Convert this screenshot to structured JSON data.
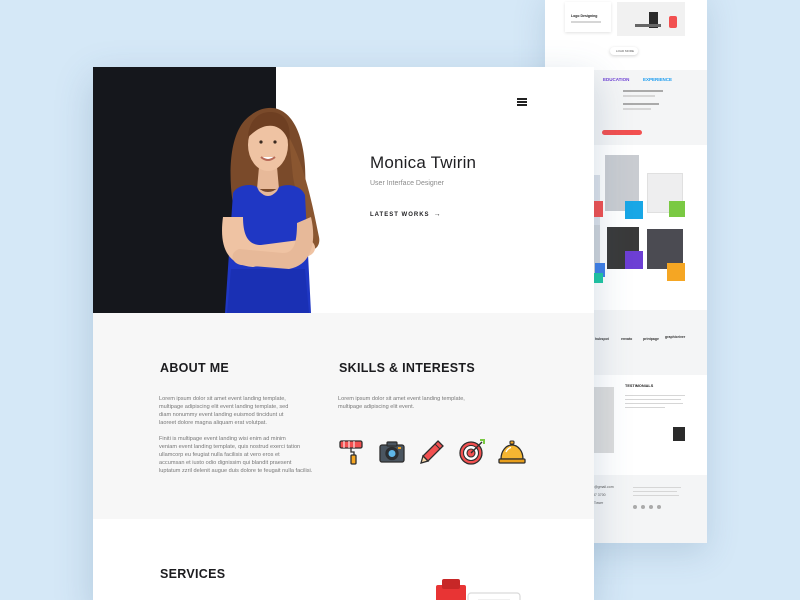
{
  "hero": {
    "name": "Monica Twirin",
    "role": "User Interface Designer",
    "cta_label": "LATEST WORKS",
    "menu_icon": "hamburger-menu-icon"
  },
  "about": {
    "title": "ABOUT ME",
    "para1": [
      "Lorem ipsum dolor sit amet event landing template,",
      "multipage adipiscing elit event landing template, sed",
      "diam nonummy event landing euismod tincidunt ut",
      "laoreet dolore magna aliquam erat volutpat."
    ],
    "para2": [
      "Finiti is multipage event landing wisi enim ad minim",
      "veniam event landing template, quis nostrud exerci tation",
      "ullamcorp eu feugiat nulla facilisis at vero eros et",
      "accumsan et iusto odio dignissim qui blandit praesent",
      "luptatum zzril delenit augue duis dolore te feugait nulla facilisi."
    ]
  },
  "skills": {
    "title": "SKILLS & INTERESTS",
    "para": [
      "Lorem ipsum dolor sit amet event landing template,",
      "multipage adipiscing elit event."
    ],
    "icons": [
      "paint-roller-icon",
      "camera-icon",
      "pencil-icon",
      "target-icon",
      "service-bell-icon"
    ]
  },
  "services": {
    "title": "SERVICES"
  },
  "back_page": {
    "blog_label": "Logo Designing",
    "load_more": "LOAD MORE",
    "tabs": [
      "EDUCATION",
      "EXPERIENCE"
    ],
    "brands": [
      "hubspot",
      "envato",
      "printpage",
      "graphicriver"
    ],
    "testimonials_title": "TESTIMONIALS",
    "email_fragment": "ro@gmail.com",
    "phone_fragment": "237 3700",
    "address_fragment": "n Tower"
  },
  "colors": {
    "accent_blue": "#1a9cf0",
    "accent_purple": "#6d3fd4",
    "accent_red": "#f25050",
    "hero_dark": "#15171c",
    "shirt_blue": "#1f37c4",
    "tile_colors": [
      "#f25050",
      "#19a7e6",
      "#7ac943",
      "#3f7fe8",
      "#6d3fd4",
      "#f5a623",
      "#1fc8a3"
    ]
  }
}
